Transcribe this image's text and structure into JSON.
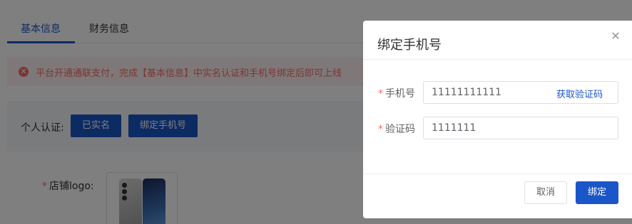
{
  "tabs": [
    {
      "label": "基本信息",
      "active": true
    },
    {
      "label": "财务信息",
      "active": false
    }
  ],
  "alert": {
    "icon": "error-circle-icon",
    "text": "平台开通通联支付，完成【基本信息】中实名认证和手机号绑定后即可上线"
  },
  "auth": {
    "label": "个人认证:",
    "verified_button": "已实名",
    "bind_phone_button": "绑定手机号"
  },
  "logo": {
    "required_mark": "*",
    "label": "店铺logo:"
  },
  "dialog": {
    "title": "绑定手机号",
    "close_icon": "close-icon",
    "phone": {
      "required_mark": "*",
      "label": "手机号",
      "value": "11111111111",
      "get_code_link": "获取验证码"
    },
    "code": {
      "required_mark": "*",
      "label": "验证码",
      "value": "1111111"
    },
    "cancel_button": "取消",
    "confirm_button": "绑定"
  },
  "colors": {
    "primary": "#1a56c7",
    "danger": "#f56c6c",
    "alert_bg": "#fef0f0",
    "overlay": "rgba(0,0,0,0.5)"
  }
}
